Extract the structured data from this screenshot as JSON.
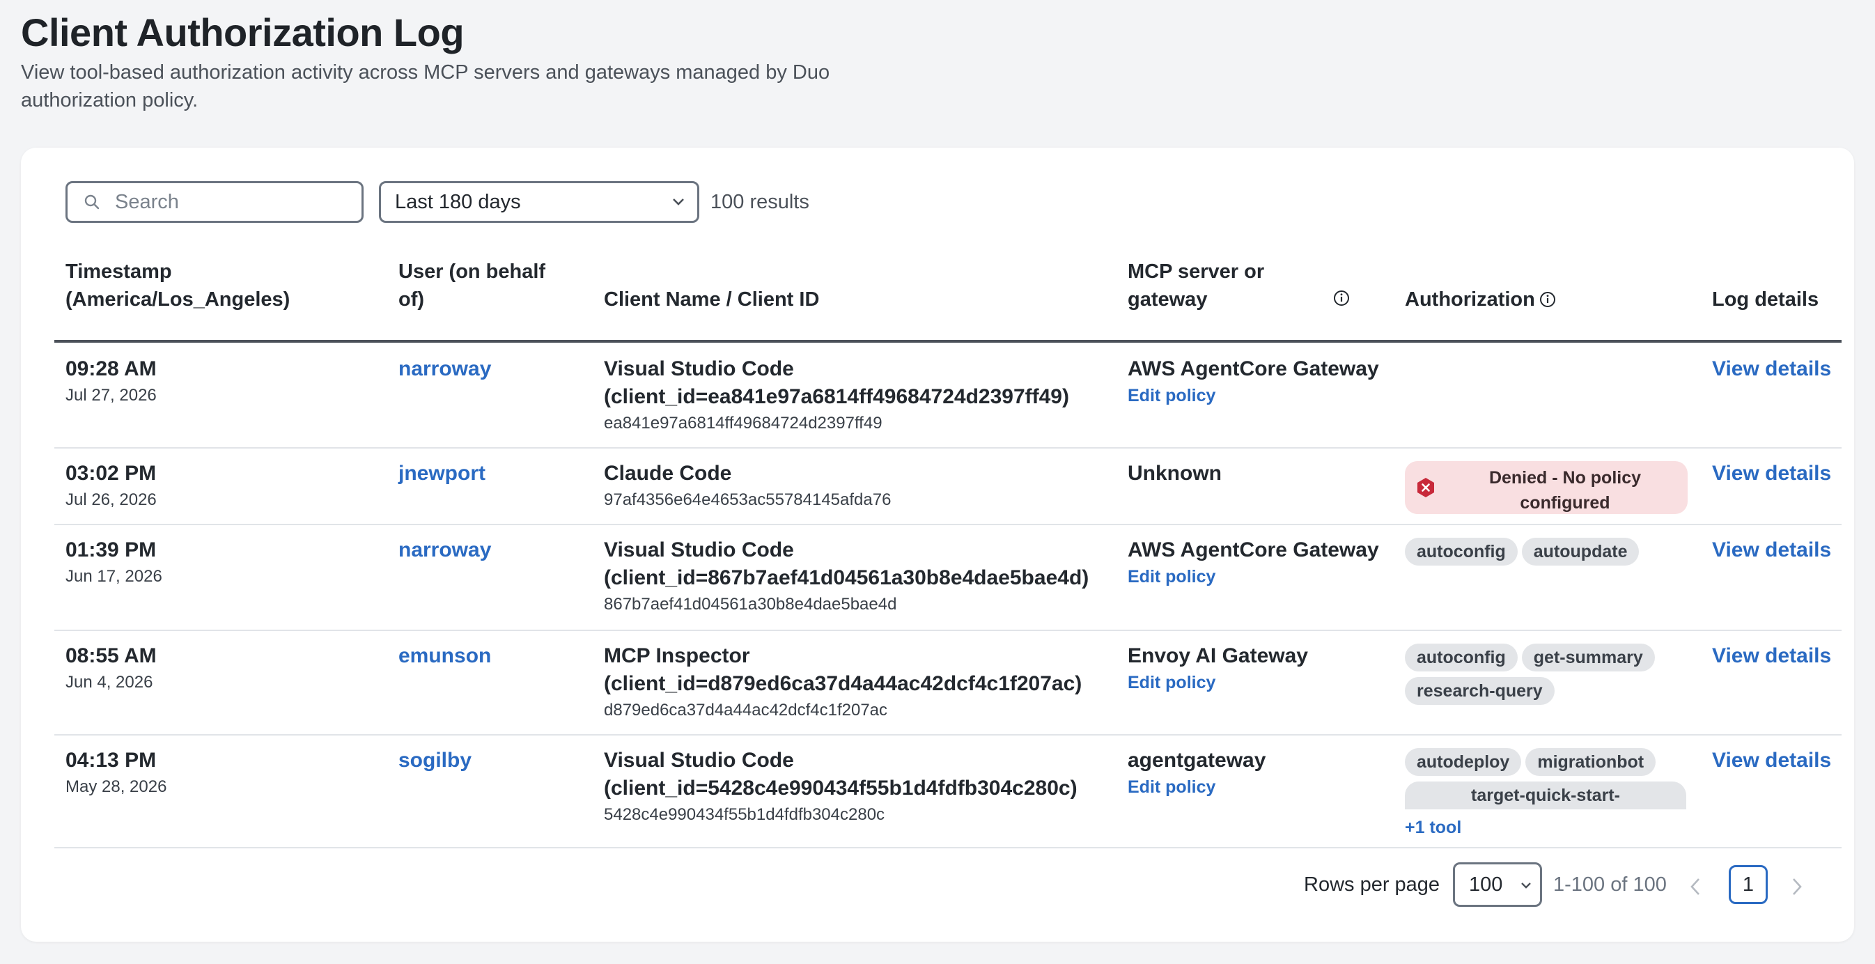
{
  "page": {
    "title": "Client Authorization Log",
    "subtitle": "View tool-based authorization activity across MCP servers and gateways managed by Duo authorization policy."
  },
  "toolbar": {
    "search_placeholder": "Search",
    "date_range": "Last 180 days",
    "results": "100 results"
  },
  "table": {
    "headers": {
      "timestamp": "Timestamp (America/Los_Angeles)",
      "user": "User (on behalf of)",
      "client": "Client Name / Client ID",
      "server": "MCP server or gateway",
      "authorization": "Authorization",
      "log": "Log details"
    },
    "rows": [
      {
        "time": "09:28 AM",
        "date": "Jul 27, 2026",
        "user": "narroway",
        "client_name": "Visual Studio Code",
        "client_id_label": "(client_id=ea841e97a6814ff49684724d2397ff49)",
        "client_id": "ea841e97a6814ff49684724d2397ff49",
        "server": "AWS AgentCore Gateway",
        "edit": "Edit policy",
        "view": "View details"
      },
      {
        "time": "03:02 PM",
        "date": "Jul 26, 2026",
        "user": "jnewport",
        "client_name": "Claude Code",
        "client_id": "97af4356e64e4653ac55784145afda76",
        "server": "Unknown",
        "status": "Denied - No policy configured",
        "view": "View details"
      },
      {
        "time": "01:39 PM",
        "date": "Jun 17, 2026",
        "user": "narroway",
        "client_name": "Visual Studio Code",
        "client_id_label": "(client_id=867b7aef41d04561a30b8e4dae5bae4d)",
        "client_id": "867b7aef41d04561a30b8e4dae5bae4d",
        "server": "AWS AgentCore Gateway",
        "edit": "Edit policy",
        "tags": [
          "autoconfig",
          "autoupdate"
        ],
        "view": "View details"
      },
      {
        "time": "08:55 AM",
        "date": "Jun 4, 2026",
        "user": "emunson",
        "client_name": "MCP Inspector",
        "client_id_label": "(client_id=d879ed6ca37d4a44ac42dcf4c1f207ac)",
        "client_id": "d879ed6ca37d4a44ac42dcf4c1f207ac",
        "server": "Envoy AI Gateway",
        "edit": "Edit policy",
        "tags": [
          "autoconfig",
          "get-summary",
          "research-query"
        ],
        "view": "View details"
      },
      {
        "time": "04:13 PM",
        "date": "May 28, 2026",
        "user": "sogilby",
        "client_name": "Visual Studio Code",
        "client_id_label": "(client_id=5428c4e990434f55b1d4fdfb304c280c)",
        "client_id": "5428c4e990434f55b1d4fdfb304c280c",
        "server": "agentgateway",
        "edit": "Edit policy",
        "tags": [
          "autodeploy",
          "migrationbot",
          "target-quick-start-"
        ],
        "more": "+1 tool",
        "view": "View details"
      }
    ]
  },
  "pagination": {
    "rows_label": "Rows per page",
    "rows_value": "100",
    "range": "1-100 of 100",
    "page": "1"
  },
  "colors": {
    "accent": "#2a6ac2",
    "denied_bg": "#f9dfe1",
    "denied_icon": "#c8293a",
    "tag_bg": "#e3e5e8"
  },
  "icons": {
    "search": "search-icon",
    "dropdown": "chevron-down-icon",
    "info": "info-icon",
    "denied": "error-hexagon-icon",
    "prev": "chevron-left-icon",
    "next": "chevron-right-icon"
  }
}
